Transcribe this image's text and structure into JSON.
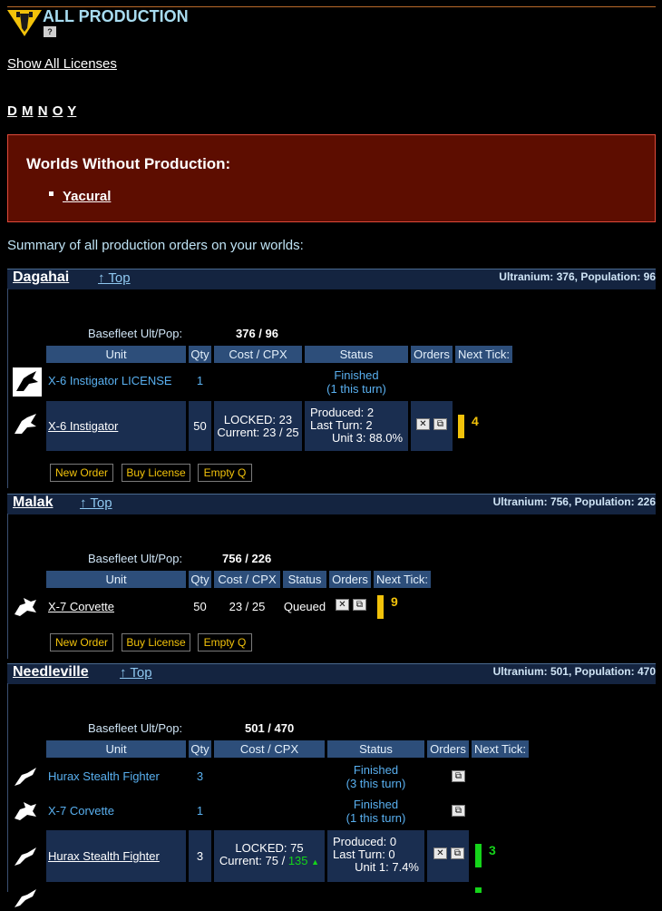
{
  "page": {
    "title": "ALL PRODUCTION",
    "help_icon": "help-icon",
    "show_all": "Show All Licenses",
    "letters": [
      "D",
      "M",
      "N",
      "O",
      "Y"
    ],
    "summary": "Summary of all production orders on your worlds:"
  },
  "no_production": {
    "heading": "Worlds Without Production:",
    "worlds": [
      "Yacural"
    ]
  },
  "colors": {
    "accent_bar": "#f2c20a",
    "green_bar": "#15d41a",
    "link": "#59b0f0",
    "header_bg": "#2d4e7a",
    "warn_bg": "#5d0d00"
  },
  "buttons": {
    "new_order": "New Order",
    "buy_license": "Buy License",
    "empty_q": "Empty Q"
  },
  "top_link": "↑ Top",
  "basefleet_label": "Basefleet Ult/Pop:",
  "headers": {
    "unit": "Unit",
    "qty": "Qty",
    "cost": "Cost / CPX",
    "status": "Status",
    "orders": "Orders",
    "next_tick": "Next Tick:"
  },
  "worlds": [
    {
      "name": "Dagahai",
      "stats": "Ultranium: 376, Population: 96",
      "basefleet": "376 / 96",
      "rows": [
        {
          "unit": "X-6 Instigator LICENSE",
          "qty": "1",
          "status_l1": "Finished",
          "status_l2": "(1 this turn)"
        },
        {
          "unit": "X-6 Instigator",
          "qty": "50",
          "cost_l1": "LOCKED: 23",
          "cost_l2": "Current: 23 / 25",
          "prod_l1": "Produced:  2",
          "prod_l2": "Last Turn:  2",
          "prod_l3": "Unit 3:  88.0%",
          "tick": "4"
        }
      ]
    },
    {
      "name": "Malak",
      "stats": "Ultranium: 756, Population: 226",
      "basefleet": "756 / 226",
      "rows": [
        {
          "unit": "X-7 Corvette",
          "qty": "50",
          "cost": "23 / 25",
          "status": "Queued",
          "tick": "9"
        }
      ]
    },
    {
      "name": "Needleville",
      "stats": "Ultranium: 501, Population: 470",
      "basefleet": "501 / 470",
      "rows": [
        {
          "unit": "Hurax Stealth Fighter",
          "qty": "3",
          "status_l1": "Finished",
          "status_l2": "(3 this turn)"
        },
        {
          "unit": "X-7 Corvette",
          "qty": "1",
          "status_l1": "Finished",
          "status_l2": "(1 this turn)"
        },
        {
          "unit": "Hurax Stealth Fighter",
          "qty": "3",
          "cost_l1": "LOCKED: 75",
          "cost_l2a": "Current: 75 /",
          "cost_l2b": "135",
          "prod_l1": "Produced:  0",
          "prod_l2": "Last Turn:  0",
          "prod_l3": "Unit 1:  7.4%",
          "tick": "3"
        }
      ]
    }
  ]
}
